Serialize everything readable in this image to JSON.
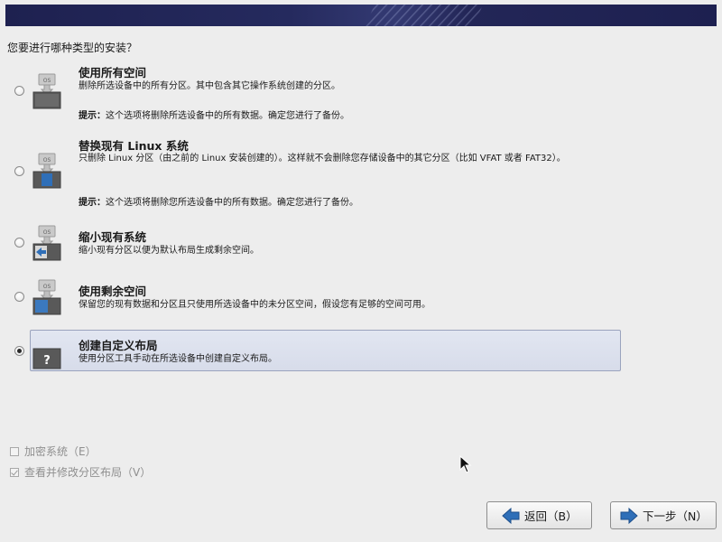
{
  "header": {
    "question": "您要进行哪种类型的安装？"
  },
  "options": [
    {
      "title": "使用所有空间",
      "desc": "删除所选设备中的所有分区。其中包含其它操作系统创建的分区。",
      "hint_label": "提示：",
      "hint_text": "这个选项将删除所选设备中的所有数据。确定您进行了备份。",
      "selected": false,
      "icon_label": "OS"
    },
    {
      "title": "替换现有 Linux 系统",
      "desc": "只删除 Linux 分区（由之前的 Linux 安装创建的）。这样就不会删除您存储设备中的其它分区（比如 VFAT 或者 FAT32）。",
      "hint_label": "提示：",
      "hint_text": "这个选项将删除您所选设备中的所有数据。确定您进行了备份。",
      "selected": false,
      "icon_label": "OS"
    },
    {
      "title": "缩小现有系统",
      "desc": "缩小现有分区以便为默认布局生成剩余空间。",
      "selected": false,
      "icon_label": "OS"
    },
    {
      "title": "使用剩余空间",
      "desc": "保留您的现有数据和分区且只使用所选设备中的未分区空间，假设您有足够的空间可用。",
      "selected": false,
      "icon_label": "OS"
    },
    {
      "title": "创建自定义布局",
      "desc": "使用分区工具手动在所选设备中创建自定义布局。",
      "selected": true,
      "icon_label": "?"
    }
  ],
  "checkboxes": {
    "encrypt": {
      "label": "加密系统（E）",
      "checked": false
    },
    "review": {
      "label": "查看并修改分区布局（V）",
      "checked": true
    }
  },
  "buttons": {
    "back_label": "返回（B）",
    "next_label": "下一步（N）"
  },
  "colors": {
    "banner": "#1e2150",
    "selected_bg": "#dde1ee",
    "arrow_blue": "#2f6fb8"
  }
}
